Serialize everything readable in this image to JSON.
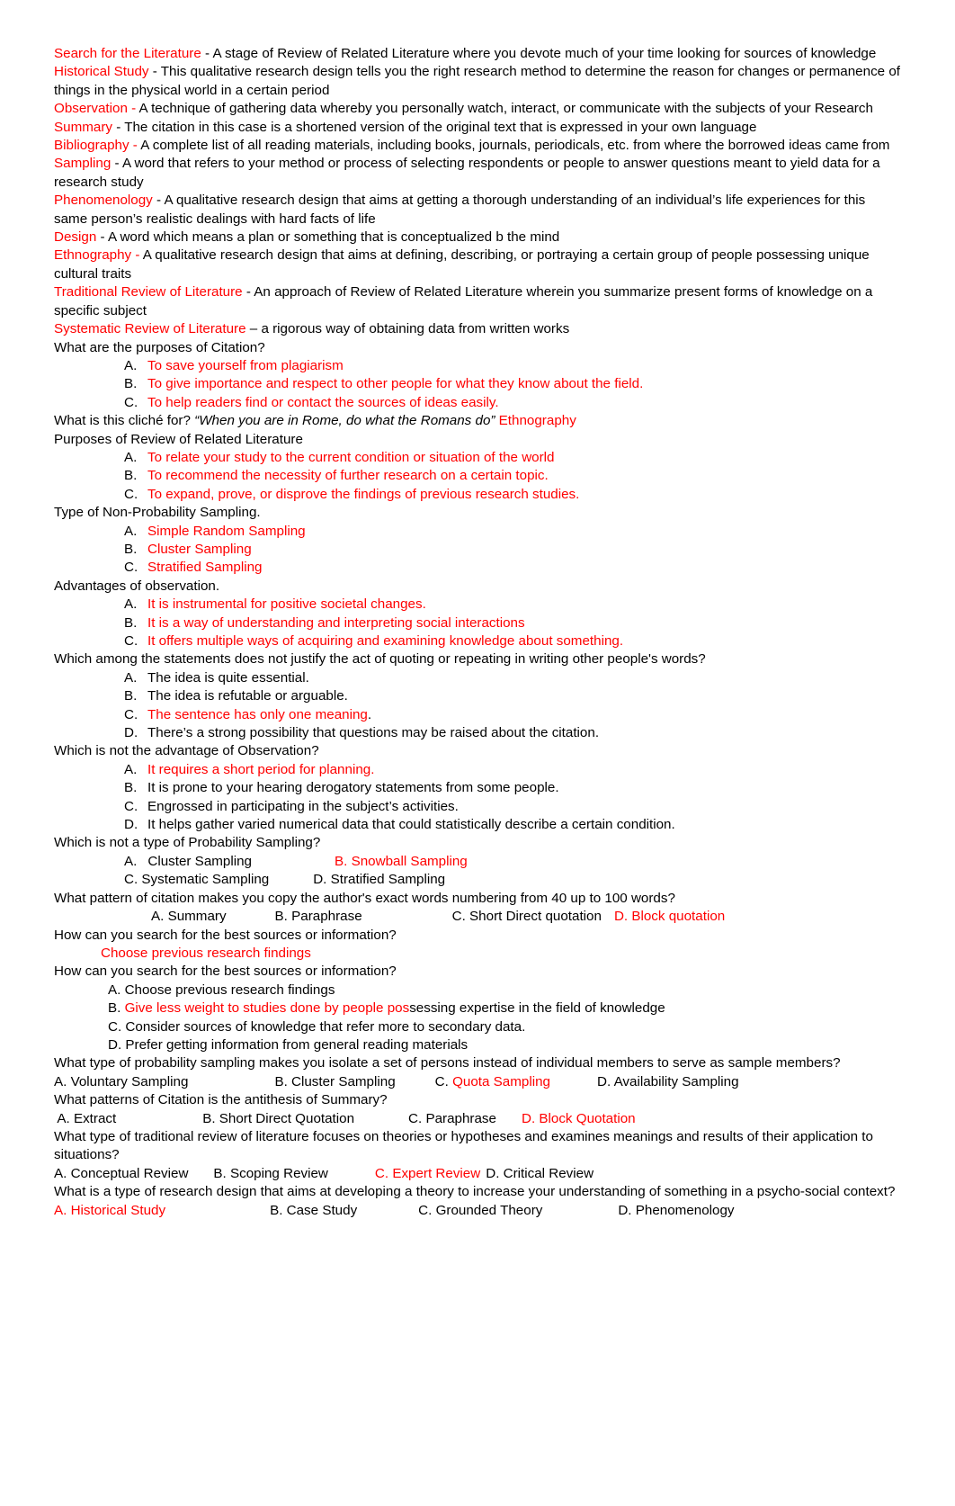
{
  "document": {
    "accent_color": "#ff0000",
    "body_color": "#000000",
    "background": "#ffffff",
    "definitions": [
      {
        "term": "Search for the Literature",
        "definition": " - A stage of Review of Related Literature where you devote much of your time  looking for sources of knowledge"
      },
      {
        "term": "Historical Study",
        "definition": "  - This qualitative research design tells you the right research method to determine the reason for changes or permanence of things in the physical world in a certain period"
      },
      {
        "term": "Observation -",
        "definition": "  A technique of gathering data whereby you personally watch, interact, or communicate with the subjects of your Research"
      },
      {
        "term": "Summary",
        "definition": " - The citation in this case is a shortened version of the original text that is expressed in your own language"
      },
      {
        "term": "Bibliography -",
        "definition": " A complete list of all reading materials, including books, journals, periodicals, etc. from where the borrowed ideas came from"
      },
      {
        "term": "Sampling",
        "definition": " - A word that refers to your method or process of selecting respondents or people to answer questions meant to yield data for a research study"
      },
      {
        "term": "Phenomenology",
        "definition": "  -  A qualitative research design that aims at getting a thorough understanding of an individual’s life experiences for this same person’s realistic dealings with hard facts of life"
      },
      {
        "term": "Design",
        "definition": " - A word which means a plan or something that is conceptualized b the mind"
      },
      {
        "term": "Ethnography -",
        "definition": " A qualitative research design that aims at defining, describing, or portraying a certain group of people possessing unique cultural traits"
      },
      {
        "term": "Traditional Review of Literature",
        "definition": " - An approach of Review of Related Literature wherein you summarize present forms of knowledge on a specific subject"
      },
      {
        "term": "Systematic Review of Literature",
        "definition": " – a rigorous way of obtaining data from written works"
      }
    ],
    "q1": {
      "question": "What are the purposes of Citation?",
      "options": [
        {
          "label": "A.",
          "text": "To save yourself from plagiarism",
          "highlight": true
        },
        {
          "label": "B.",
          "text": "To give importance and respect to other people for what they know about the field.",
          "highlight": true
        },
        {
          "label": "C.",
          "text": "To help readers find or contact the sources of ideas easily.",
          "highlight": true
        }
      ]
    },
    "q2": {
      "prefix": "What is this cliché for? ",
      "quote": "“When you are in Rome, do what the Romans do”",
      "answer": " Ethnography"
    },
    "q3": {
      "question": "Purposes of Review of Related Literature",
      "options": [
        {
          "label": "A.",
          "text": "To relate your study to the current condition or situation of the world",
          "highlight": true
        },
        {
          "label": "B.",
          "text": "To recommend the necessity of further research on a certain topic.",
          "highlight": true
        },
        {
          "label": "C.",
          "text": "To expand, prove, or disprove the findings of previous research studies.",
          "highlight": true
        }
      ]
    },
    "q4": {
      "question": "Type of Non-Probability Sampling.",
      "options": [
        {
          "label": "A.",
          "text": "Simple Random Sampling",
          "highlight": true
        },
        {
          "label": "B.",
          "text": "Cluster Sampling",
          "highlight": true
        },
        {
          "label": "C.",
          "text": "Stratified Sampling",
          "highlight": true
        }
      ]
    },
    "q5": {
      "question": "Advantages of observation.",
      "options": [
        {
          "label": "A.",
          "text": "It is instrumental for positive societal changes.",
          "highlight": true
        },
        {
          "label": "B.",
          "text": "It is a way of understanding and interpreting social interactions",
          "highlight": true
        },
        {
          "label": "C.",
          "text": "It offers multiple ways of acquiring and examining knowledge about something.",
          "highlight": true
        }
      ]
    },
    "q6": {
      "question": "Which among the statements does not justify the act of quoting or repeating in writing other people's words?",
      "options": [
        {
          "label": "A.",
          "text": "The idea is quite essential.",
          "highlight": false
        },
        {
          "label": "B.",
          "text": "The idea is refutable or arguable.",
          "highlight": false
        },
        {
          "label": "C.",
          "text": "The sentence has only one meaning",
          "trailer": ".",
          "highlight": true
        },
        {
          "label": "D.",
          "text": "There’s a strong possibility that questions may be raised about the citation.",
          "highlight": false
        }
      ]
    },
    "q7": {
      "question": "Which is not the advantage of Observation?",
      "options": [
        {
          "label": "A.",
          "text": "It requires a short period for planning.",
          "highlight": true
        },
        {
          "label": "B.",
          "text": "It is prone to your hearing derogatory statements from some people.",
          "highlight": false
        },
        {
          "label": "C.",
          "text": "Engrossed in participating in the subject’s activities.",
          "highlight": false
        },
        {
          "label": "D.",
          "text": "It helps gather varied numerical data that could statistically describe a certain condition.",
          "highlight": false
        }
      ]
    },
    "q8": {
      "question": "Which is not a type of Probability Sampling?",
      "row1_a_label": "A.",
      "row1_a": "Cluster Sampling",
      "row1_b": "B. Snowball Sampling",
      "row2_a": "C. Systematic Sampling",
      "row2_b": "D. Stratified Sampling"
    },
    "q9": {
      "question": "What pattern of citation makes you copy the author's exact words numbering from 40 up to 100 words?",
      "a": "A. Summary",
      "b": "B. Paraphrase",
      "c": "C. Short Direct quotation",
      "d": "D. Block quotation"
    },
    "q10": {
      "question": "How can you search for the best sources or information?",
      "answer": "Choose previous research findings"
    },
    "q11": {
      "question": "How can you search for the best sources or information?",
      "opt_a": "A. Choose previous research findings",
      "opt_b_label": "B. ",
      "opt_b_red": "Give less weight to studies done by people pos",
      "opt_b_black": "sessing expertise in the field of knowledge",
      "opt_c": "C. Consider sources of knowledge that refer more to secondary data.",
      "opt_d": "D. Prefer getting information from general reading materials"
    },
    "q12": {
      "question": "What type of probability sampling makes you isolate a set of persons instead of individual members to serve as  sample members?",
      "a": "A. Voluntary Sampling",
      "b": "B. Cluster Sampling",
      "c_label": "C. ",
      "c_red": "Quota Sampling",
      "d": "D. Availability Sampling"
    },
    "q13": {
      "question": " What patterns of Citation is the antithesis of Summary?",
      "a": " A. Extract",
      "b": "B. Short Direct Quotation",
      "c": "C. Paraphrase",
      "d": "D. Block Quotation"
    },
    "q14": {
      "question": "What type of traditional review of literature focuses on theories or hypotheses and examines meanings and results of their application to situations?",
      "a": "A. Conceptual Review",
      "b": "B. Scoping Review",
      "c": "C. Expert Review",
      "d": "D. Critical Review"
    },
    "q15": {
      "question": "What is a type of research design that aims at developing a theory to increase your understanding of something in a psycho-social context?",
      "a": "A. Historical Study",
      "b": "B. Case Study",
      "c": "C. Grounded Theory",
      "d": "D. Phenomenology"
    }
  }
}
